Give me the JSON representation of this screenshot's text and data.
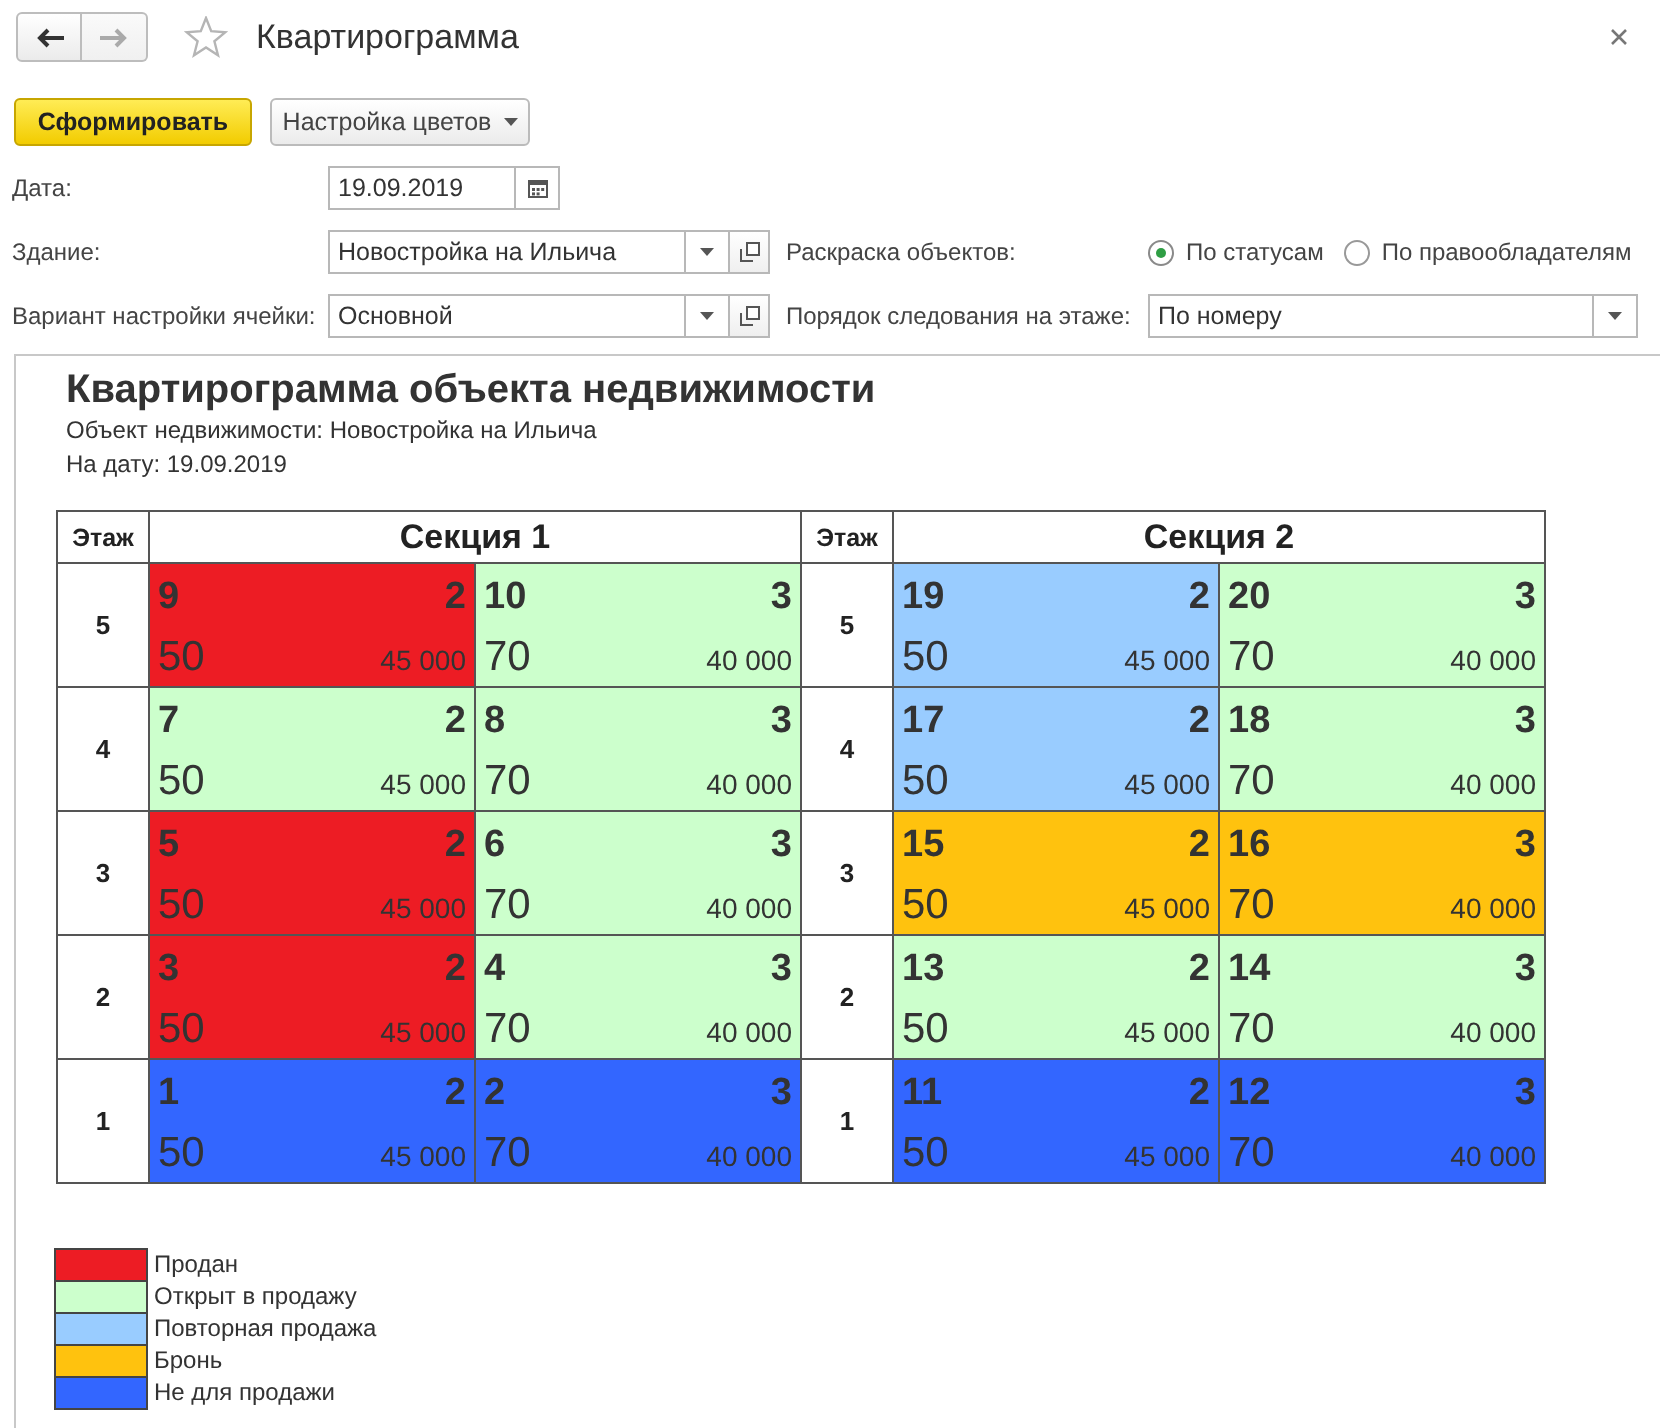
{
  "window": {
    "title": "Квартирограмма",
    "favorite": false,
    "navigation": [
      {
        "kind": "back",
        "disabled": false
      },
      {
        "kind": "forward",
        "disabled": true
      }
    ]
  },
  "toolbar": {
    "buttons": [
      {
        "label": "Сформировать",
        "kind": "primary"
      },
      {
        "label": "Настройка цветов",
        "kind": "dropdown"
      }
    ]
  },
  "form": {
    "date": {
      "label": "Дата:",
      "value": "19.09.2019",
      "kind": "date"
    },
    "building": {
      "label": "Здание:",
      "value": "Новостройка на Ильича",
      "kind": "select_open"
    },
    "cell_settings": {
      "label": "Вариант настройки ячейки:",
      "value": "Основной",
      "kind": "select_open"
    },
    "coloring": {
      "label": "Раскраска объектов:",
      "options": [
        {
          "label": "По статусам",
          "selected": true
        },
        {
          "label": "По правообладателям",
          "selected": false
        }
      ]
    },
    "floor_order": {
      "label": "Порядок следования на этаже:",
      "value": "По номеру",
      "kind": "select"
    }
  },
  "report": {
    "title": "Квартирограмма объекта недвижимости",
    "subtitle_lines": [
      "Объект недвижимости: Новостройка на Ильича",
      "На дату: 19.09.2019"
    ],
    "sections": [
      {
        "floor_header": "Этаж",
        "title": "Секция 1",
        "floors": [
          {
            "floor": "5",
            "apartments": [
              {
                "number": "9",
                "rooms": "2",
                "area": "50",
                "price": "45 000",
                "color": "#ed1c24"
              },
              {
                "number": "10",
                "rooms": "3",
                "area": "70",
                "price": "40 000",
                "color": "#ccffcc"
              }
            ]
          },
          {
            "floor": "4",
            "apartments": [
              {
                "number": "7",
                "rooms": "2",
                "area": "50",
                "price": "45 000",
                "color": "#ccffcc"
              },
              {
                "number": "8",
                "rooms": "3",
                "area": "70",
                "price": "40 000",
                "color": "#ccffcc"
              }
            ]
          },
          {
            "floor": "3",
            "apartments": [
              {
                "number": "5",
                "rooms": "2",
                "area": "50",
                "price": "45 000",
                "color": "#ed1c24"
              },
              {
                "number": "6",
                "rooms": "3",
                "area": "70",
                "price": "40 000",
                "color": "#ccffcc"
              }
            ]
          },
          {
            "floor": "2",
            "apartments": [
              {
                "number": "3",
                "rooms": "2",
                "area": "50",
                "price": "45 000",
                "color": "#ed1c24"
              },
              {
                "number": "4",
                "rooms": "3",
                "area": "70",
                "price": "40 000",
                "color": "#ccffcc"
              }
            ]
          },
          {
            "floor": "1",
            "apartments": [
              {
                "number": "1",
                "rooms": "2",
                "area": "50",
                "price": "45 000",
                "color": "#3366ff"
              },
              {
                "number": "2",
                "rooms": "3",
                "area": "70",
                "price": "40 000",
                "color": "#3366ff"
              }
            ]
          }
        ]
      },
      {
        "floor_header": "Этаж",
        "title": "Секция 2",
        "floors": [
          {
            "floor": "5",
            "apartments": [
              {
                "number": "19",
                "rooms": "2",
                "area": "50",
                "price": "45 000",
                "color": "#99ccff"
              },
              {
                "number": "20",
                "rooms": "3",
                "area": "70",
                "price": "40 000",
                "color": "#ccffcc"
              }
            ]
          },
          {
            "floor": "4",
            "apartments": [
              {
                "number": "17",
                "rooms": "2",
                "area": "50",
                "price": "45 000",
                "color": "#99ccff"
              },
              {
                "number": "18",
                "rooms": "3",
                "area": "70",
                "price": "40 000",
                "color": "#ccffcc"
              }
            ]
          },
          {
            "floor": "3",
            "apartments": [
              {
                "number": "15",
                "rooms": "2",
                "area": "50",
                "price": "45 000",
                "color": "#ffc20e"
              },
              {
                "number": "16",
                "rooms": "3",
                "area": "70",
                "price": "40 000",
                "color": "#ffc20e"
              }
            ]
          },
          {
            "floor": "2",
            "apartments": [
              {
                "number": "13",
                "rooms": "2",
                "area": "50",
                "price": "45 000",
                "color": "#ccffcc"
              },
              {
                "number": "14",
                "rooms": "3",
                "area": "70",
                "price": "40 000",
                "color": "#ccffcc"
              }
            ]
          },
          {
            "floor": "1",
            "apartments": [
              {
                "number": "11",
                "rooms": "2",
                "area": "50",
                "price": "45 000",
                "color": "#3366ff"
              },
              {
                "number": "12",
                "rooms": "3",
                "area": "70",
                "price": "40 000",
                "color": "#3366ff"
              }
            ]
          }
        ]
      }
    ],
    "legend": [
      {
        "label": "Продан",
        "color": "#ed1c24"
      },
      {
        "label": "Открыт в продажу",
        "color": "#ccffcc"
      },
      {
        "label": "Повторная продажа",
        "color": "#99ccff"
      },
      {
        "label": "Бронь",
        "color": "#ffc20e"
      },
      {
        "label": "Не для продажи",
        "color": "#3366ff"
      }
    ]
  }
}
